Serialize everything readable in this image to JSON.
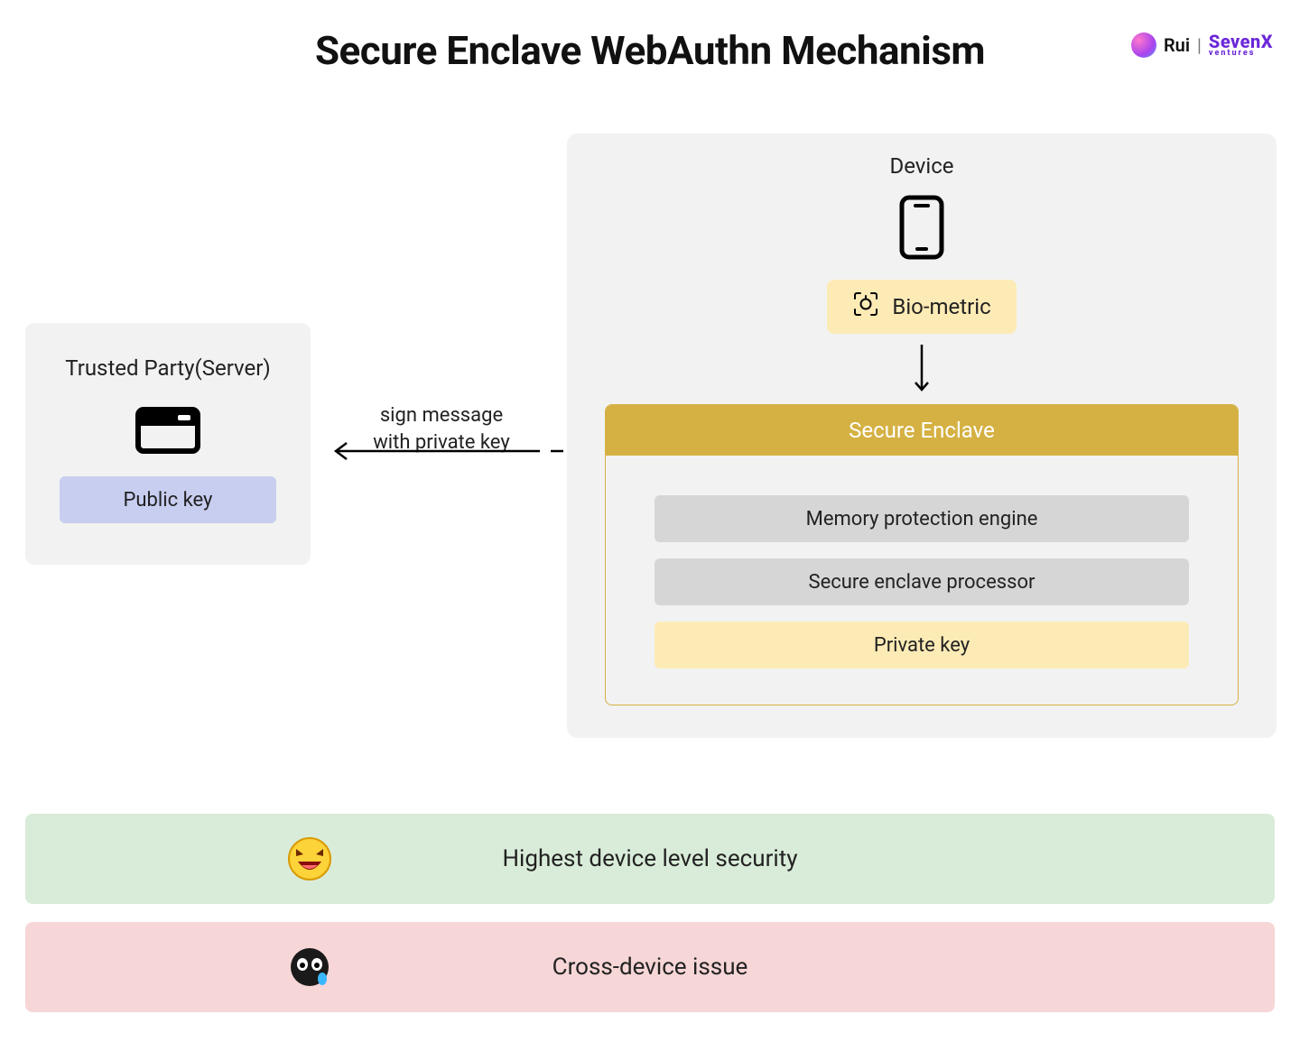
{
  "title": "Secure Enclave WebAuthn Mechanism",
  "branding": {
    "name": "Rui",
    "separator": "|",
    "logo_main": "SevenX",
    "logo_sub": "ventures"
  },
  "left": {
    "title": "Trusted Party(Server)",
    "public_key": "Public key"
  },
  "arrow": {
    "line1": "sign message",
    "line2": "with private key"
  },
  "device": {
    "title": "Device",
    "biometric": "Bio-metric",
    "enclave_header": "Secure Enclave",
    "row1": "Memory protection engine",
    "row2": "Secure enclave processor",
    "row3": "Private key"
  },
  "footer": {
    "positive": "Highest device level security",
    "negative": "Cross-device issue"
  }
}
